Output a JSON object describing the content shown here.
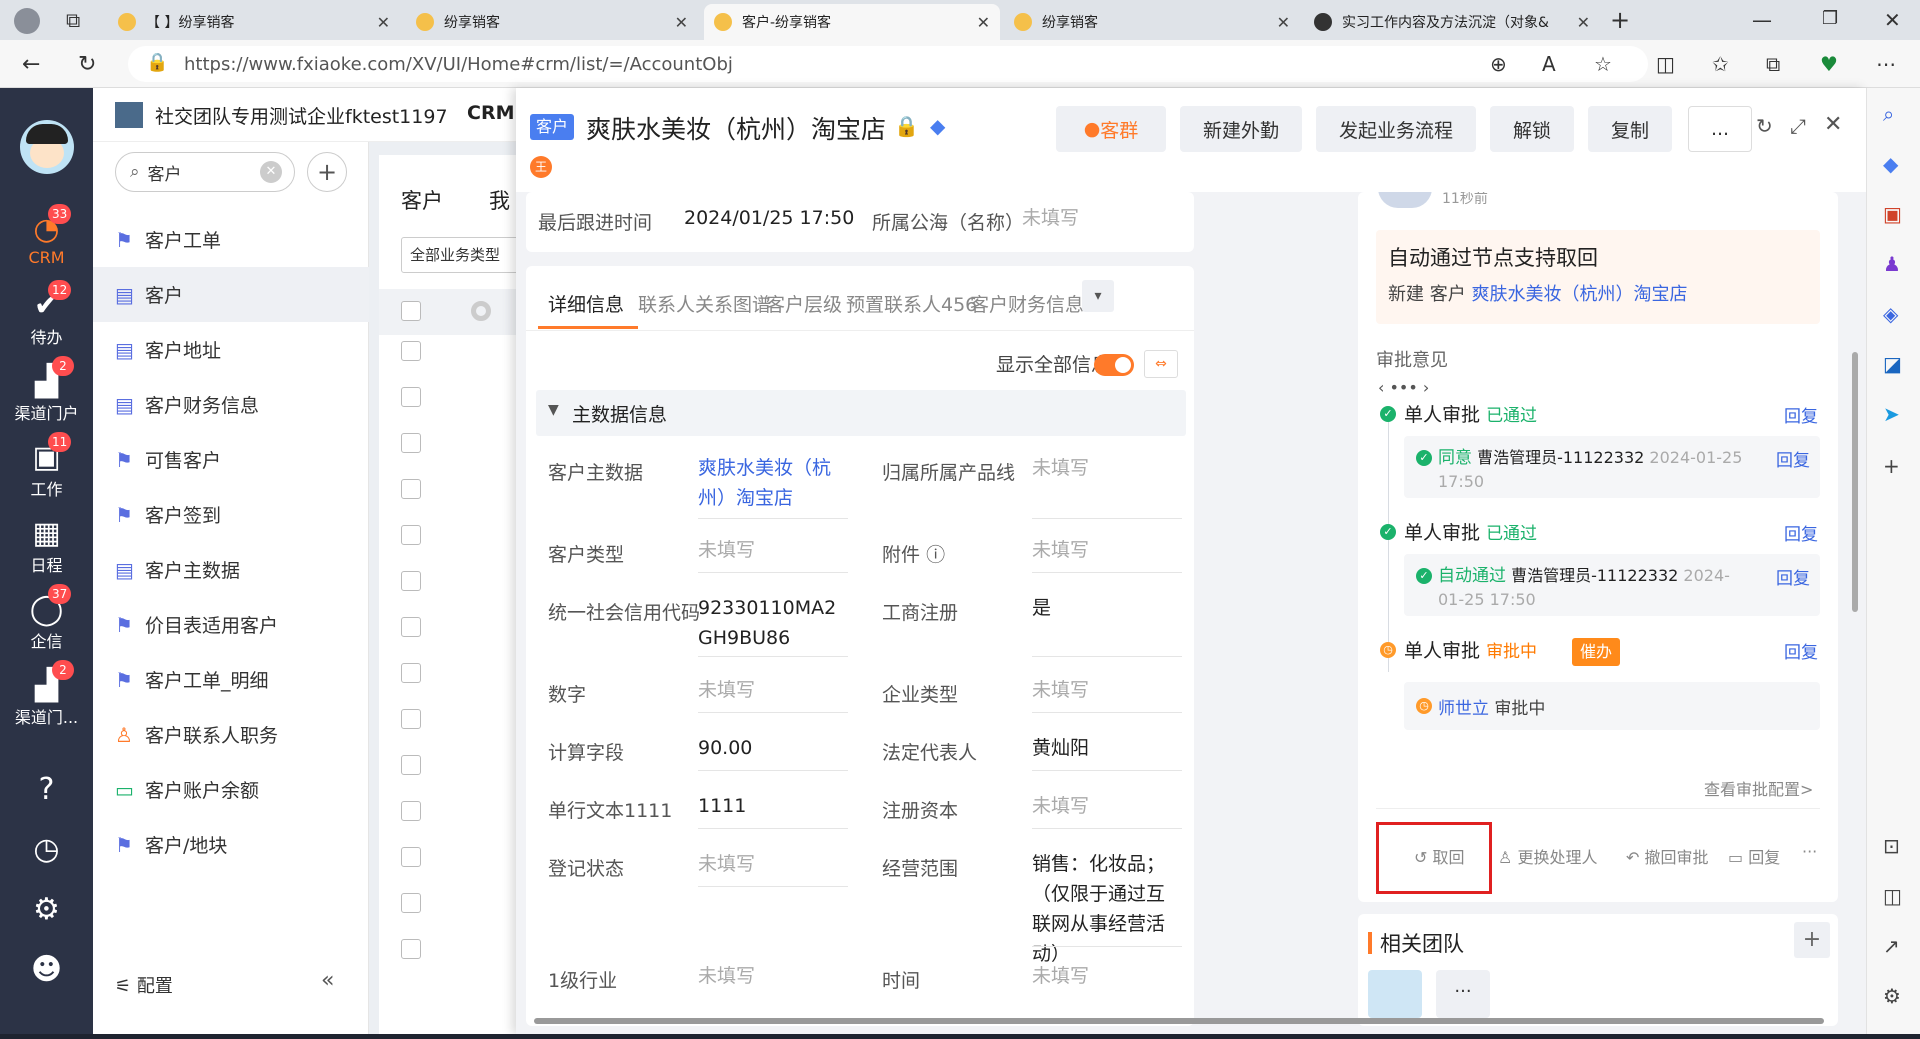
{
  "browser": {
    "tabs": [
      {
        "label": "【          】纷享销客"
      },
      {
        "label": "纷享销客"
      },
      {
        "label": "客户-纷享销客"
      },
      {
        "label": "纷享销客"
      },
      {
        "label": "实习工作内容及方法沉淀（对象&"
      }
    ],
    "url": "https://www.fxiaoke.com/XV/UI/Home#crm/list/=/AccountObj"
  },
  "leftnav": {
    "items": [
      {
        "label": "CRM",
        "badge": "33"
      },
      {
        "label": "待办",
        "badge": "12"
      },
      {
        "label": "渠道门户",
        "badge": "2"
      },
      {
        "label": "工作",
        "badge": "11"
      },
      {
        "label": "日程",
        "badge": ""
      },
      {
        "label": "企信",
        "badge": "37"
      },
      {
        "label": "渠道门...",
        "badge": "2"
      }
    ]
  },
  "sidebar": {
    "company": "社交团队专用测试企业fktest1197",
    "crm_label": "CRM",
    "search_value": "客户",
    "items": [
      "客户工单",
      "客户",
      "客户地址",
      "客户财务信息",
      "可售客户",
      "客户签到",
      "客户主数据",
      "价目表适用客户",
      "客户工单_明细",
      "客户联系人职务",
      "客户账户余额",
      "客户/地块"
    ],
    "config_label": "配置"
  },
  "list": {
    "tab1": "客户",
    "tab2": "我",
    "filter": "全部业务类型"
  },
  "detail": {
    "obj_tag": "客户",
    "title": "爽肤水美妆（杭州）淘宝店",
    "owner_initial": "王",
    "buttons": {
      "group": "客群",
      "field_work": "新建外勤",
      "start_flow": "发起业务流程",
      "unlock": "解锁",
      "copy": "复制",
      "more": "..."
    },
    "last_follow_label": "最后跟进时间",
    "last_follow_value": "2024/01/25 17:50",
    "pool_label": "所属公海（名称）",
    "pool_value": "未填写",
    "tabs": [
      "详细信息",
      "联系人关系图谱",
      "客户层级",
      "预置联系人456",
      "客户财务信息"
    ],
    "show_all_label": "显示全部信息",
    "section_title": "主数据信息",
    "fields": [
      {
        "l1": "客户主数据",
        "v1": "爽肤水美妆（杭州）淘宝店",
        "l2": "归属所属产品线",
        "v2": "未填写"
      },
      {
        "l1": "客户类型",
        "v1": "未填写",
        "l2": "附件",
        "v2": "未填写"
      },
      {
        "l1": "统一社会信用代码",
        "v1": "92330110MA2GH9BU86",
        "l2": "工商注册",
        "v2": "是"
      },
      {
        "l1": "数字",
        "v1": "未填写",
        "l2": "企业类型",
        "v2": "未填写"
      },
      {
        "l1": "计算字段",
        "v1": "90.00",
        "l2": "法定代表人",
        "v2": "黄灿阳"
      },
      {
        "l1": "单行文本1111",
        "v1": "1111",
        "l2": "注册资本",
        "v2": "未填写"
      },
      {
        "l1": "登记状态",
        "v1": "未填写",
        "l2": "经营范围",
        "v2": "销售：化妆品；（仅限于通过互联网从事经营活动）"
      },
      {
        "l1": "1级行业",
        "v1": "未填写",
        "l2": "时间",
        "v2": "未填写"
      }
    ]
  },
  "approval": {
    "time_ago": "11秒前",
    "notice_title": "自动通过节点支持取回",
    "notice_prefix": "新建 客户",
    "notice_link": "爽肤水美妆（杭州）淘宝店",
    "opinion_label": "审批意见",
    "nodes": [
      {
        "title": "单人审批",
        "status": "已通过",
        "reply": "回复",
        "sub_action": "同意",
        "sub_user": "曹浩管理员-11122332",
        "sub_time": "2024-01-25 17:50",
        "sub_reply": "回复"
      },
      {
        "title": "单人审批",
        "status": "已通过",
        "reply": "回复",
        "sub_action": "自动通过",
        "sub_user": "曹浩管理员-11122332",
        "sub_time": "2024-01-25 17:50",
        "sub_reply": "回复"
      },
      {
        "title": "单人审批",
        "status": "审批中",
        "reply": "回复",
        "urge": "催办",
        "sub_user": "师世立",
        "sub_status": "审批中"
      }
    ],
    "view_config": "查看审批配置>",
    "actions": {
      "retrieve": "取回",
      "change": "更换处理人",
      "revoke": "撤回审批",
      "reply": "回复",
      "more": "···"
    },
    "team_title": "相关团队"
  },
  "colors": {
    "accent": "#ff7a2a",
    "link": "#3a66e0",
    "nav_bg": "#2c3346",
    "highlight_box": "#e02020"
  }
}
